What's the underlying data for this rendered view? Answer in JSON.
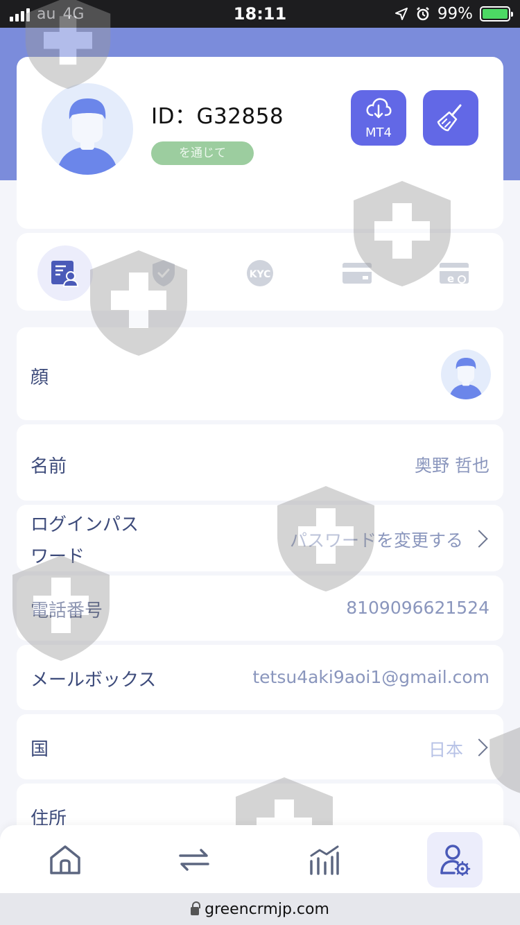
{
  "status_bar": {
    "carrier": "au",
    "network": "4G",
    "time": "18:11",
    "battery_percent": "99%"
  },
  "profile": {
    "id_label": "ID：G32858",
    "status_badge": "を通じて",
    "mt4_label": "MT4"
  },
  "tabs": [
    {
      "icon": "id-card-icon",
      "active": true
    },
    {
      "icon": "shield-check-icon",
      "active": false
    },
    {
      "icon": "kyc-icon",
      "label": "KYC",
      "active": false
    },
    {
      "icon": "bank-card-icon",
      "active": false
    },
    {
      "icon": "e-wallet-icon",
      "active": false
    }
  ],
  "rows": {
    "face": {
      "label": "顔"
    },
    "name": {
      "label": "名前",
      "value": "奥野 哲也"
    },
    "password": {
      "label_line1": "ログインパス",
      "label_line2": "ワード",
      "value": "パスワードを変更する"
    },
    "phone": {
      "label": "電話番号",
      "value": "8109096621524"
    },
    "email": {
      "label": "メールボックス",
      "value": "tetsu4aki9aoi1@gmail.com"
    },
    "country": {
      "label": "国",
      "value": "日本"
    },
    "address": {
      "label": "住所"
    }
  },
  "bottom_nav": [
    {
      "icon": "home-icon",
      "active": false
    },
    {
      "icon": "transfer-arrows-icon",
      "active": false
    },
    {
      "icon": "chart-icon",
      "active": false
    },
    {
      "icon": "user-settings-icon",
      "active": true
    }
  ],
  "browser": {
    "url": "greencrmjp.com"
  },
  "colors": {
    "primary": "#6268e6",
    "header_bg": "#7b8cdb",
    "badge_green": "#9ccd9f",
    "label_text": "#3c4a7a",
    "value_text": "#8a96bd"
  }
}
